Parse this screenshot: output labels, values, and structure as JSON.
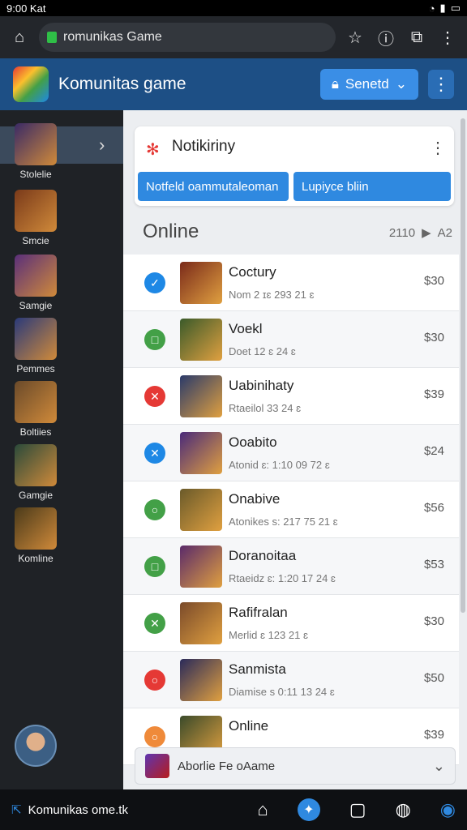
{
  "status": {
    "left": "9:00 Kat",
    "right_icons": [
      "wifi-icon",
      "signal-icon",
      "battery-icon"
    ]
  },
  "browser": {
    "url": "romunikas Game",
    "icons": [
      "home-icon",
      "bookmark-star-icon",
      "info-icon",
      "tabs-icon",
      "menu-icon"
    ]
  },
  "app": {
    "title": "Komunitas game",
    "send_label": "Senetd"
  },
  "sidebar": {
    "items": [
      {
        "label": "Stolelie",
        "color": "#3a2a66"
      },
      {
        "label": "Smcie",
        "color": "#7a3a1a"
      },
      {
        "label": "Samgie",
        "color": "#5a2f7a"
      },
      {
        "label": "Pemmes",
        "color": "#2a3a7a"
      },
      {
        "label": "Boltiies",
        "color": "#6a4a2a"
      },
      {
        "label": "Gamgie",
        "color": "#2a4a3a"
      },
      {
        "label": "Komline",
        "color": "#4a3a1a"
      }
    ]
  },
  "notif": {
    "title": "Notikiriny",
    "btn1": "Notfeld oammutaleoman",
    "btn2": "Lupiyce bliin"
  },
  "section": {
    "title": "Online",
    "count": "2110",
    "page": "A2"
  },
  "games": [
    {
      "name": "Coctury",
      "meta": "Nom 2 ɪɛ       293 21 ɛ",
      "price": "$30",
      "status_color": "#1e88e5",
      "status_glyph": "✓",
      "thumb": "#7a2a1a"
    },
    {
      "name": "Voekl",
      "meta": "Doet 12 ɛ          24 ɛ",
      "price": "$30",
      "status_color": "#43a047",
      "status_glyph": "□",
      "thumb": "#3a5a2a"
    },
    {
      "name": "Uabinihaty",
      "meta": "Rtaeilol 33 24          ɛ",
      "price": "$39",
      "status_color": "#e53935",
      "status_glyph": "✕",
      "thumb": "#2a3a6a"
    },
    {
      "name": "Ooabito",
      "meta": "Atonid ɛ:  1:10 09 72 ɛ",
      "price": "$24",
      "status_color": "#1e88e5",
      "status_glyph": "✕",
      "thumb": "#4a2a7a"
    },
    {
      "name": "Onabive",
      "meta": "Atonikes s:  217 75 21 ɛ",
      "price": "$56",
      "status_color": "#43a047",
      "status_glyph": "○",
      "thumb": "#6a5a2a"
    },
    {
      "name": "Doranoitaa",
      "meta": "Rtaeidz ɛ:  1:20 17 24 ɛ",
      "price": "$53",
      "status_color": "#43a047",
      "status_glyph": "□",
      "thumb": "#5a2a6a"
    },
    {
      "name": "Rafifralan",
      "meta": "Merlid ɛ         123 21 ɛ",
      "price": "$30",
      "status_color": "#43a047",
      "status_glyph": "✕",
      "thumb": "#7a4a2a"
    },
    {
      "name": "Sanmista",
      "meta": "Diamise s   0:11 13 24 ɛ",
      "price": "$50",
      "status_color": "#e53935",
      "status_glyph": "○",
      "thumb": "#2a2a5a"
    },
    {
      "name": "Online",
      "meta": "",
      "price": "$39",
      "status_color": "#ef8a3a",
      "status_glyph": "○",
      "thumb": "#3a4a2a"
    }
  ],
  "bottomcard": {
    "label": "Aborlie Fe oAame"
  },
  "nav": {
    "label": "Komunikas ome.tk",
    "icons": [
      "back-icon",
      "home-icon",
      "game-icon",
      "tabs-icon",
      "controller-icon",
      "profile-icon"
    ]
  }
}
